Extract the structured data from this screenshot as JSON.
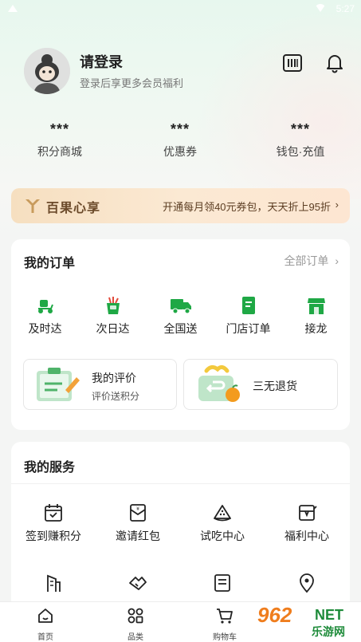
{
  "status_bar": {
    "time": "5:27"
  },
  "profile": {
    "title": "请登录",
    "subtitle": "登录后享更多会员福利"
  },
  "stats": [
    {
      "value": "***",
      "label": "积分商城"
    },
    {
      "value": "***",
      "label": "优惠券"
    },
    {
      "value": "***",
      "label": "钱包·充值"
    }
  ],
  "vip_banner": {
    "brand": "百果心享",
    "promo": "开通每月领40元券包，天天折上95折",
    "arrow": "›"
  },
  "orders": {
    "title": "我的订单",
    "all_link": "全部订单",
    "items": [
      {
        "label": "及时达",
        "icon": "scooter-icon"
      },
      {
        "label": "次日达",
        "icon": "produce-bag-icon"
      },
      {
        "label": "全国送",
        "icon": "truck-icon"
      },
      {
        "label": "门店订单",
        "icon": "receipt-icon"
      },
      {
        "label": "接龙",
        "icon": "storefront-icon"
      }
    ],
    "review": {
      "title": "我的评价",
      "subtitle": "评价送积分"
    },
    "refund": {
      "title": "三无退货"
    }
  },
  "services": {
    "title": "我的服务",
    "items": [
      {
        "label": "签到赚积分",
        "icon": "calendar-check-icon"
      },
      {
        "label": "邀请红包",
        "icon": "red-envelope-icon"
      },
      {
        "label": "试吃中心",
        "icon": "watermelon-slice-icon"
      },
      {
        "label": "福利中心",
        "icon": "gift-card-icon"
      },
      {
        "label": "",
        "icon": "building-icon"
      },
      {
        "label": "",
        "icon": "handshake-icon"
      },
      {
        "label": "",
        "icon": "document-icon"
      },
      {
        "label": "",
        "icon": "location-pin-icon"
      }
    ]
  },
  "tabbar": [
    {
      "label": "首页",
      "icon": "home-icon"
    },
    {
      "label": "品类",
      "icon": "category-grid-icon"
    },
    {
      "label": "购物车",
      "icon": "cart-icon"
    }
  ],
  "watermark": {
    "number": "962",
    "net": "NET",
    "cn": "乐游网"
  },
  "colors": {
    "accent_green": "#1fa845",
    "vip_brown": "#6b4a2a"
  }
}
